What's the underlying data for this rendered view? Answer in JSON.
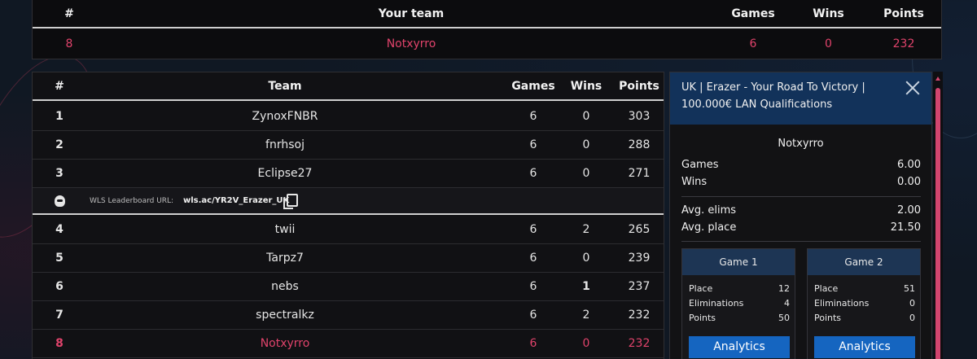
{
  "your_team": {
    "headers": {
      "rank": "#",
      "team": "Your team",
      "games": "Games",
      "wins": "Wins",
      "points": "Points"
    },
    "row": {
      "rank": "8",
      "team": "Notxyrro",
      "games": "6",
      "wins": "0",
      "points": "232"
    }
  },
  "leaderboard": {
    "headers": {
      "rank": "#",
      "team": "Team",
      "games": "Games",
      "wins": "Wins",
      "points": "Points"
    },
    "rows": [
      {
        "rank": "1",
        "team": "ZynoxFNBR",
        "games": "6",
        "wins": "0",
        "points": "303"
      },
      {
        "rank": "2",
        "team": "fnrhsoj",
        "games": "6",
        "wins": "0",
        "points": "288"
      },
      {
        "rank": "3",
        "team": "Eclipse27",
        "games": "6",
        "wins": "0",
        "points": "271"
      },
      {
        "rank": "4",
        "team": "twii",
        "games": "6",
        "wins": "2",
        "points": "265"
      },
      {
        "rank": "5",
        "team": "Tarpz7",
        "games": "6",
        "wins": "0",
        "points": "239"
      },
      {
        "rank": "6",
        "team": "nebs",
        "games": "6",
        "wins": "1",
        "points": "237"
      },
      {
        "rank": "7",
        "team": "spectralkz",
        "games": "6",
        "wins": "2",
        "points": "232"
      },
      {
        "rank": "8",
        "team": "Notxyrro",
        "games": "6",
        "wins": "0",
        "points": "232"
      }
    ],
    "wls": {
      "label": "WLS Leaderboard URL:",
      "url": "wls.ac/YR2V_Erazer_UK"
    }
  },
  "panel": {
    "title": "UK | Erazer - Your Road To Victory | 100.000€ LAN Qualifications",
    "team": "Notxyrro",
    "stats": [
      {
        "label": "Games",
        "value": "6.00"
      },
      {
        "label": "Wins",
        "value": "0.00"
      },
      {
        "label": "Avg. elims",
        "value": "2.00"
      },
      {
        "label": "Avg. place",
        "value": "21.50"
      }
    ],
    "games": [
      {
        "title": "Game 1",
        "place_label": "Place",
        "place": "12",
        "elims_label": "Eliminations",
        "elims": "4",
        "points_label": "Points",
        "points": "50",
        "button": "Analytics"
      },
      {
        "title": "Game 2",
        "place_label": "Place",
        "place": "51",
        "elims_label": "Eliminations",
        "elims": "0",
        "points_label": "Points",
        "points": "0",
        "button": "Analytics"
      }
    ]
  },
  "colors": {
    "highlight": "#e0436b",
    "accent_blue": "#1565c0",
    "panel_header": "#12325a"
  }
}
